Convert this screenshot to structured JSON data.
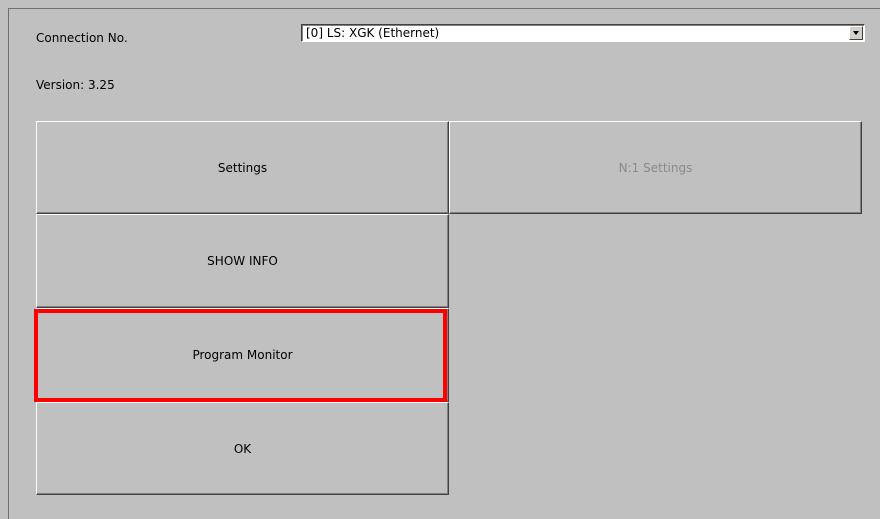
{
  "connection": {
    "label": "Connection No.",
    "selected_value": "[0] LS: XGK (Ethernet)"
  },
  "version": {
    "text": "Version:  3.25"
  },
  "buttons": {
    "settings": "Settings",
    "n1_settings": "N:1 Settings",
    "show_info": "SHOW INFO",
    "program_monitor": "Program Monitor",
    "ok": "OK"
  },
  "colors": {
    "background": "#c0c0c0",
    "highlight": "#ff0000",
    "disabled_text": "#8a8a8a"
  }
}
